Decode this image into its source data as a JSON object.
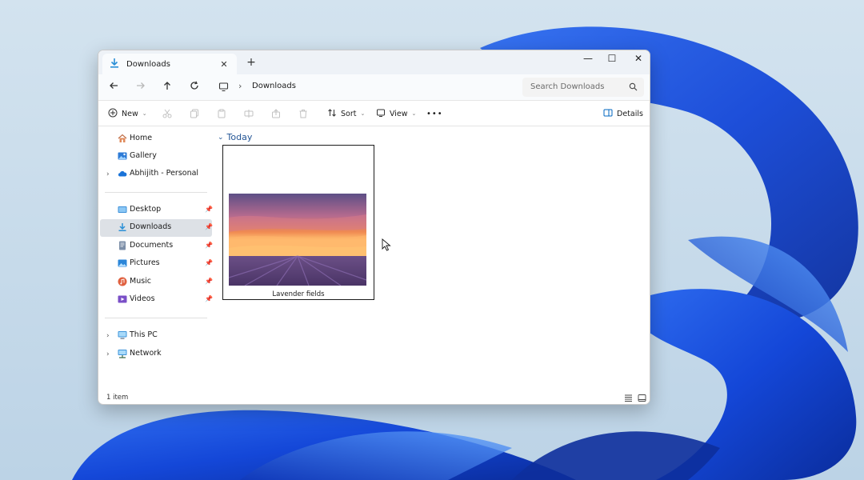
{
  "window": {
    "tab": {
      "title": "Downloads",
      "close_label": "✕",
      "icon": "downloads-icon"
    },
    "new_tab_label": "+",
    "controls": {
      "minimize": "—",
      "maximize": "☐",
      "close": "✕"
    }
  },
  "address": {
    "breadcrumb_separator": "›",
    "current_folder": "Downloads",
    "search_placeholder": "Search Downloads"
  },
  "toolbar": {
    "new_label": "New",
    "sort_label": "Sort",
    "view_label": "View",
    "more_label": "•••",
    "details_label": "Details"
  },
  "sidebar": {
    "home": "Home",
    "gallery": "Gallery",
    "onedrive": "Abhijith - Personal",
    "quick_access": [
      {
        "label": "Desktop",
        "icon": "desktop-folder-icon"
      },
      {
        "label": "Downloads",
        "icon": "downloads-folder-icon"
      },
      {
        "label": "Documents",
        "icon": "documents-folder-icon"
      },
      {
        "label": "Pictures",
        "icon": "pictures-folder-icon"
      },
      {
        "label": "Music",
        "icon": "music-folder-icon"
      },
      {
        "label": "Videos",
        "icon": "videos-folder-icon"
      }
    ],
    "this_pc": "This PC",
    "network": "Network"
  },
  "content": {
    "group_header": "Today",
    "files": [
      {
        "name": "Lavender fields"
      }
    ]
  },
  "status": {
    "item_count": "1 item"
  },
  "colors": {
    "accent": "#0067c0",
    "selected_nav": "#dde1e6",
    "group_header": "#235595"
  }
}
